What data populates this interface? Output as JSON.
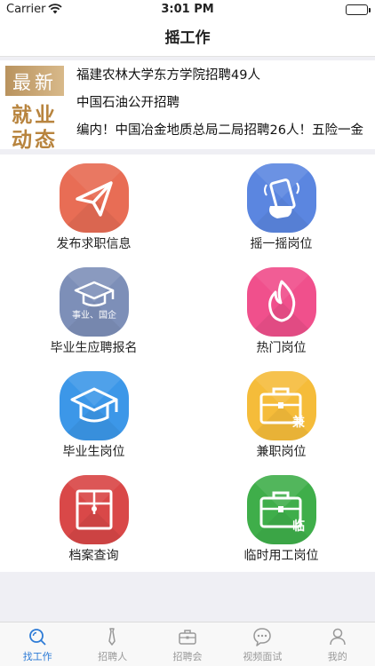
{
  "status_bar": {
    "carrier": "Carrier",
    "time": "3:01 PM"
  },
  "nav": {
    "title": "摇工作"
  },
  "news": {
    "badge": {
      "top": "最新",
      "mid": "就业",
      "bottom": "动态"
    },
    "items": [
      "福建农林大学东方学院招聘49人",
      "中国石油公开招聘",
      "编内！中国冶金地质总局二局招聘26人！五险一金"
    ]
  },
  "tiles": [
    {
      "label": "发布求职信息",
      "icon": "paper-plane-icon",
      "color": "#e86d55"
    },
    {
      "label": "摇一摇岗位",
      "icon": "shake-phone-icon",
      "color": "#5b86e0"
    },
    {
      "label": "毕业生应聘报名",
      "icon": "graduation-cap-icon",
      "color": "#7d8fb8",
      "icon_text": "事业、国企"
    },
    {
      "label": "热门岗位",
      "icon": "flame-icon",
      "color": "#f0508c"
    },
    {
      "label": "毕业生岗位",
      "icon": "graduation-cap-icon",
      "color": "#3c97e8"
    },
    {
      "label": "兼职岗位",
      "icon": "briefcase-icon",
      "color": "#f5bc3a",
      "icon_text": "兼"
    },
    {
      "label": "档案查询",
      "icon": "archive-box-icon",
      "color": "#d94848"
    },
    {
      "label": "临时用工岗位",
      "icon": "briefcase-icon",
      "color": "#3fae4a",
      "icon_text": "临"
    }
  ],
  "tab_bar": {
    "items": [
      {
        "label": "找工作",
        "icon": "search-icon",
        "active": true
      },
      {
        "label": "招聘人",
        "icon": "tie-icon",
        "active": false
      },
      {
        "label": "招聘会",
        "icon": "briefcase-icon",
        "active": false
      },
      {
        "label": "视频面试",
        "icon": "chat-bubble-icon",
        "active": false
      },
      {
        "label": "我的",
        "icon": "person-icon",
        "active": false
      }
    ],
    "active_color": "#2d7bd6",
    "inactive_color": "#999999"
  }
}
